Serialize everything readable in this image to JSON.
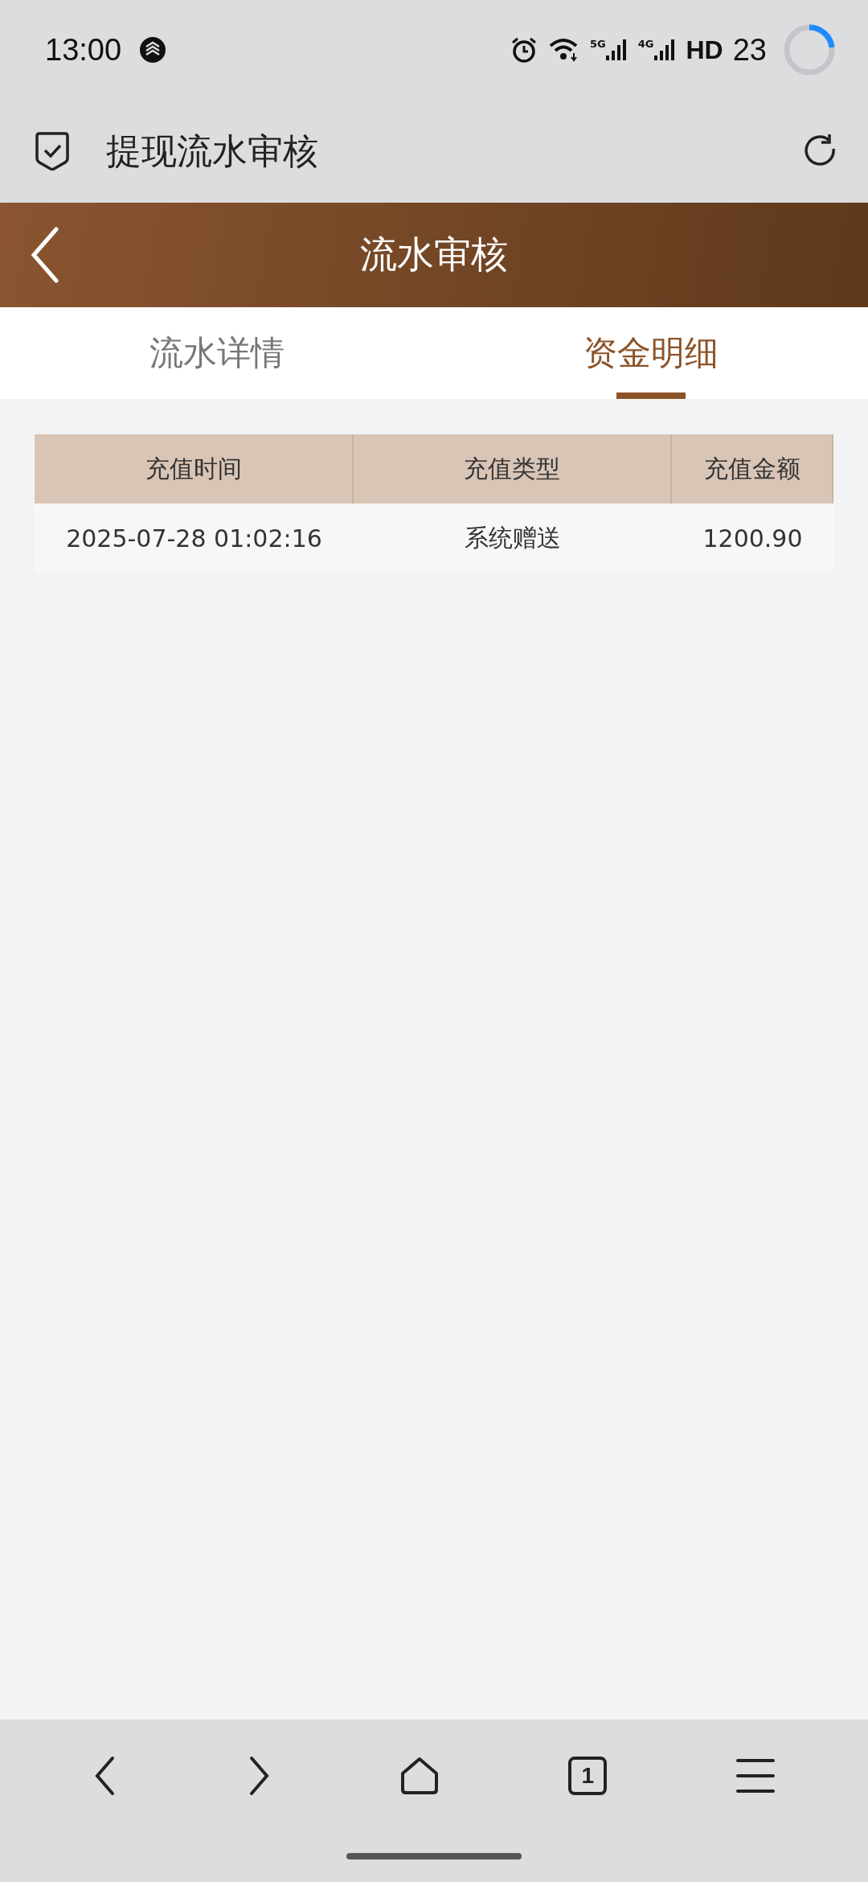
{
  "status_bar": {
    "time": "13:00",
    "signals": [
      {
        "label": "5G"
      },
      {
        "label": "4G"
      }
    ],
    "hd": "HD",
    "battery": "23"
  },
  "browser_bar": {
    "title": "提现流水审核"
  },
  "header": {
    "title": "流水审核"
  },
  "tabs": [
    {
      "label": "流水详情",
      "selected": false
    },
    {
      "label": "资金明细",
      "selected": true
    }
  ],
  "table": {
    "columns": [
      "充值时间",
      "充值类型",
      "充值金额"
    ],
    "rows": [
      [
        "2025-07-28 01:02:16",
        "系统赠送",
        "1200.90"
      ]
    ]
  },
  "bottom_nav": {
    "tab_count": "1"
  }
}
